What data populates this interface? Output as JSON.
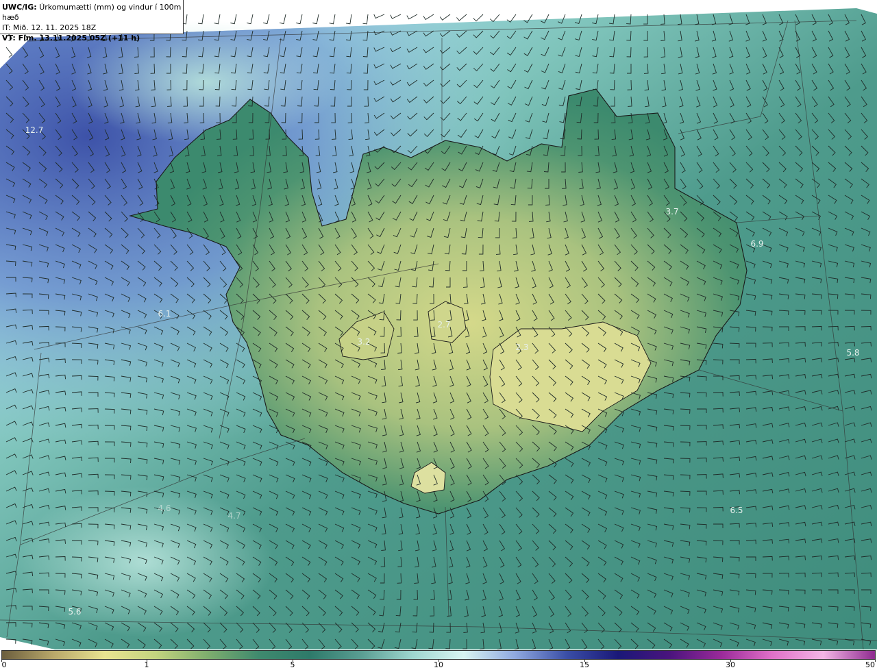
{
  "title": {
    "product": "UWC/IG:",
    "description": "Úrkomumætti (mm) og vindur í 100m hæð",
    "issue_time": "IT: Mið. 12. 11. 2025 18Z",
    "valid_time": "VT: Fim. 13.11.2025 05Z (+11 h)"
  },
  "colorbar": {
    "ticks": [
      "0",
      "1",
      "5",
      "10",
      "15",
      "30",
      "50"
    ],
    "colors": [
      "#6b5e3e",
      "#b9a86a",
      "#e8e391",
      "#c3d47f",
      "#7fae6e",
      "#3f8a6e",
      "#2e7a6a",
      "#5a9e93",
      "#9fd6d0",
      "#d8f4f2",
      "#8fa8df",
      "#3a4ea6",
      "#1a1878",
      "#4a147d",
      "#9a2a9a",
      "#e070c8",
      "#f3b5e5",
      "#8e2a8f"
    ]
  },
  "value_labels": [
    {
      "text": "12.7"
    },
    {
      "text": "3.7"
    },
    {
      "text": "6.9"
    },
    {
      "text": "6.1"
    },
    {
      "text": "3.2"
    },
    {
      "text": "2.7"
    },
    {
      "text": "2.3"
    },
    {
      "text": "5.8"
    },
    {
      "text": "6.5"
    },
    {
      "text": "5.6"
    },
    {
      "text": "4.6"
    },
    {
      "text": "4.7"
    }
  ]
}
